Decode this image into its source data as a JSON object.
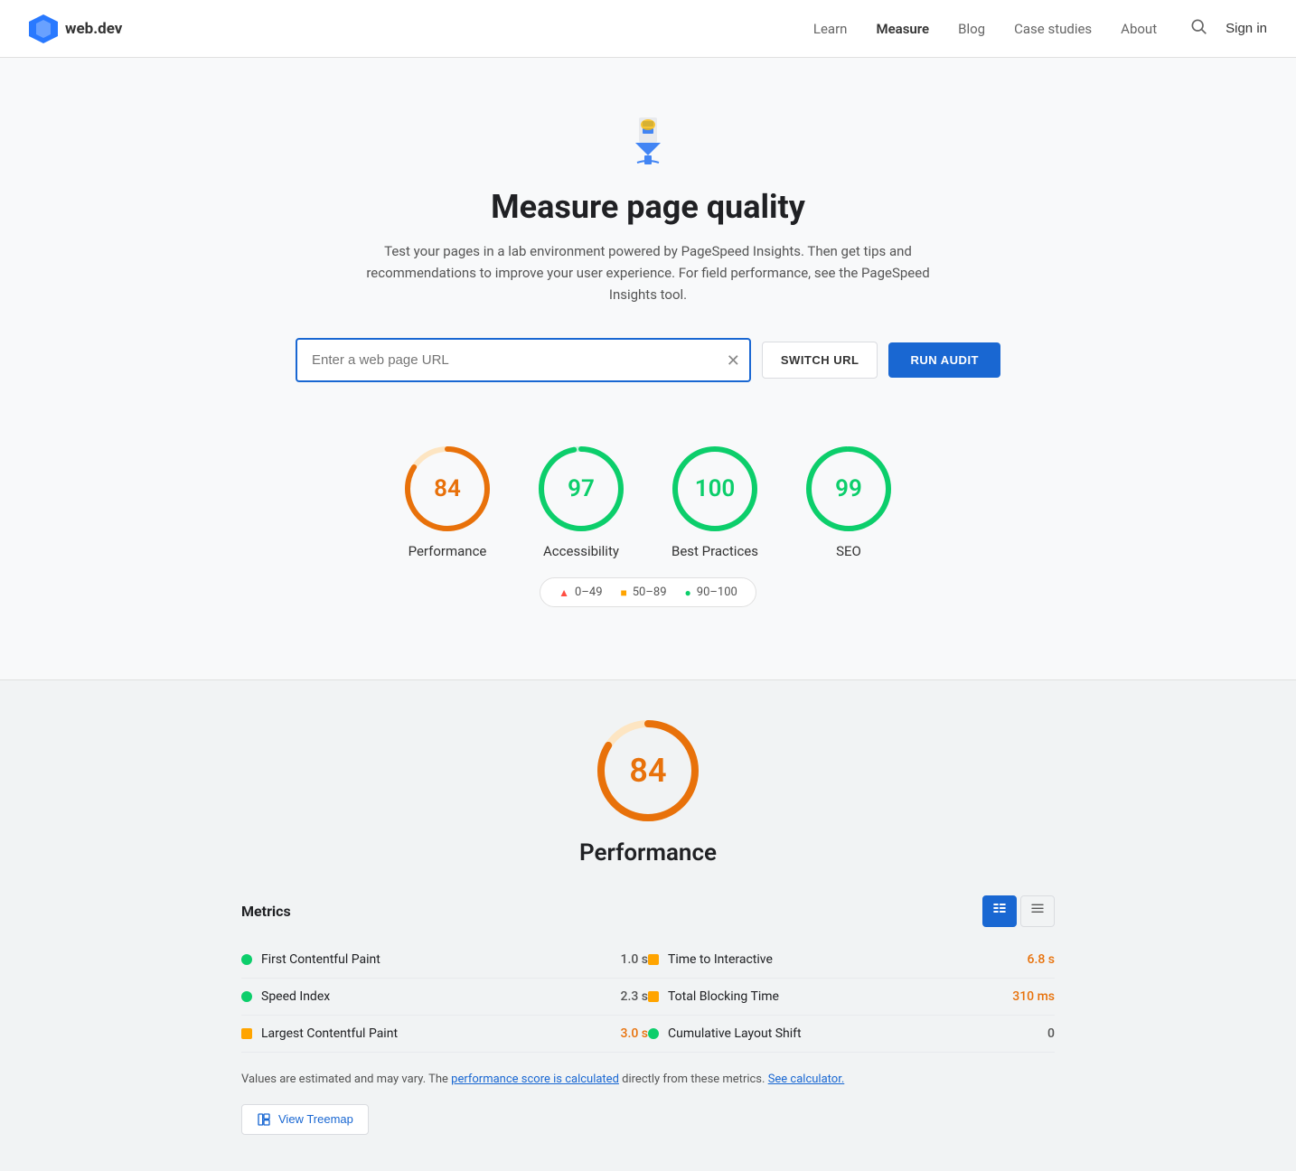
{
  "nav": {
    "logo_text": "web.dev",
    "links": [
      {
        "label": "Learn",
        "active": false
      },
      {
        "label": "Measure",
        "active": true
      },
      {
        "label": "Blog",
        "active": false
      },
      {
        "label": "Case studies",
        "active": false
      },
      {
        "label": "About",
        "active": false
      }
    ],
    "signin_label": "Sign in"
  },
  "hero": {
    "title": "Measure page quality",
    "description": "Test your pages in a lab environment powered by PageSpeed Insights. Then get tips and recommendations to improve your user experience. For field performance, see the PageSpeed Insights tool."
  },
  "url_bar": {
    "placeholder": "Enter a web page URL",
    "switch_url_label": "SWITCH URL",
    "run_audit_label": "RUN AUDIT"
  },
  "scores": [
    {
      "value": 84,
      "label": "Performance",
      "color": "#e8710a",
      "ring_color": "#e8710a",
      "track_color": "#fde5c2"
    },
    {
      "value": 97,
      "label": "Accessibility",
      "color": "#0cce6b",
      "ring_color": "#0cce6b",
      "track_color": "#c6f4dc"
    },
    {
      "value": 100,
      "label": "Best Practices",
      "color": "#0cce6b",
      "ring_color": "#0cce6b",
      "track_color": "#c6f4dc"
    },
    {
      "value": 99,
      "label": "SEO",
      "color": "#0cce6b",
      "ring_color": "#0cce6b",
      "track_color": "#c6f4dc"
    }
  ],
  "legend": [
    {
      "symbol": "▲",
      "range": "0–49",
      "color": "#ff4e42"
    },
    {
      "symbol": "■",
      "range": "50–89",
      "color": "#ffa400"
    },
    {
      "symbol": "●",
      "range": "90–100",
      "color": "#0cce6b"
    }
  ],
  "performance": {
    "score": 84,
    "title": "Performance"
  },
  "metrics": {
    "title": "Metrics",
    "items_left": [
      {
        "name": "First Contentful Paint",
        "value": "1.0 s",
        "dot_class": "green",
        "value_class": "normal"
      },
      {
        "name": "Speed Index",
        "value": "2.3 s",
        "dot_class": "green",
        "value_class": "normal"
      },
      {
        "name": "Largest Contentful Paint",
        "value": "3.0 s",
        "dot_class": "orange square",
        "value_class": "orange"
      }
    ],
    "items_right": [
      {
        "name": "Time to Interactive",
        "value": "6.8 s",
        "dot_class": "orange square",
        "value_class": "orange"
      },
      {
        "name": "Total Blocking Time",
        "value": "310 ms",
        "dot_class": "orange square",
        "value_class": "orange"
      },
      {
        "name": "Cumulative Layout Shift",
        "value": "0",
        "dot_class": "green",
        "value_class": "normal"
      }
    ],
    "note": "Values are estimated and may vary. The",
    "note_link1": "performance score is calculated",
    "note_middle": "directly from these metrics.",
    "note_link2": "See calculator.",
    "treemap_label": "View Treemap"
  }
}
